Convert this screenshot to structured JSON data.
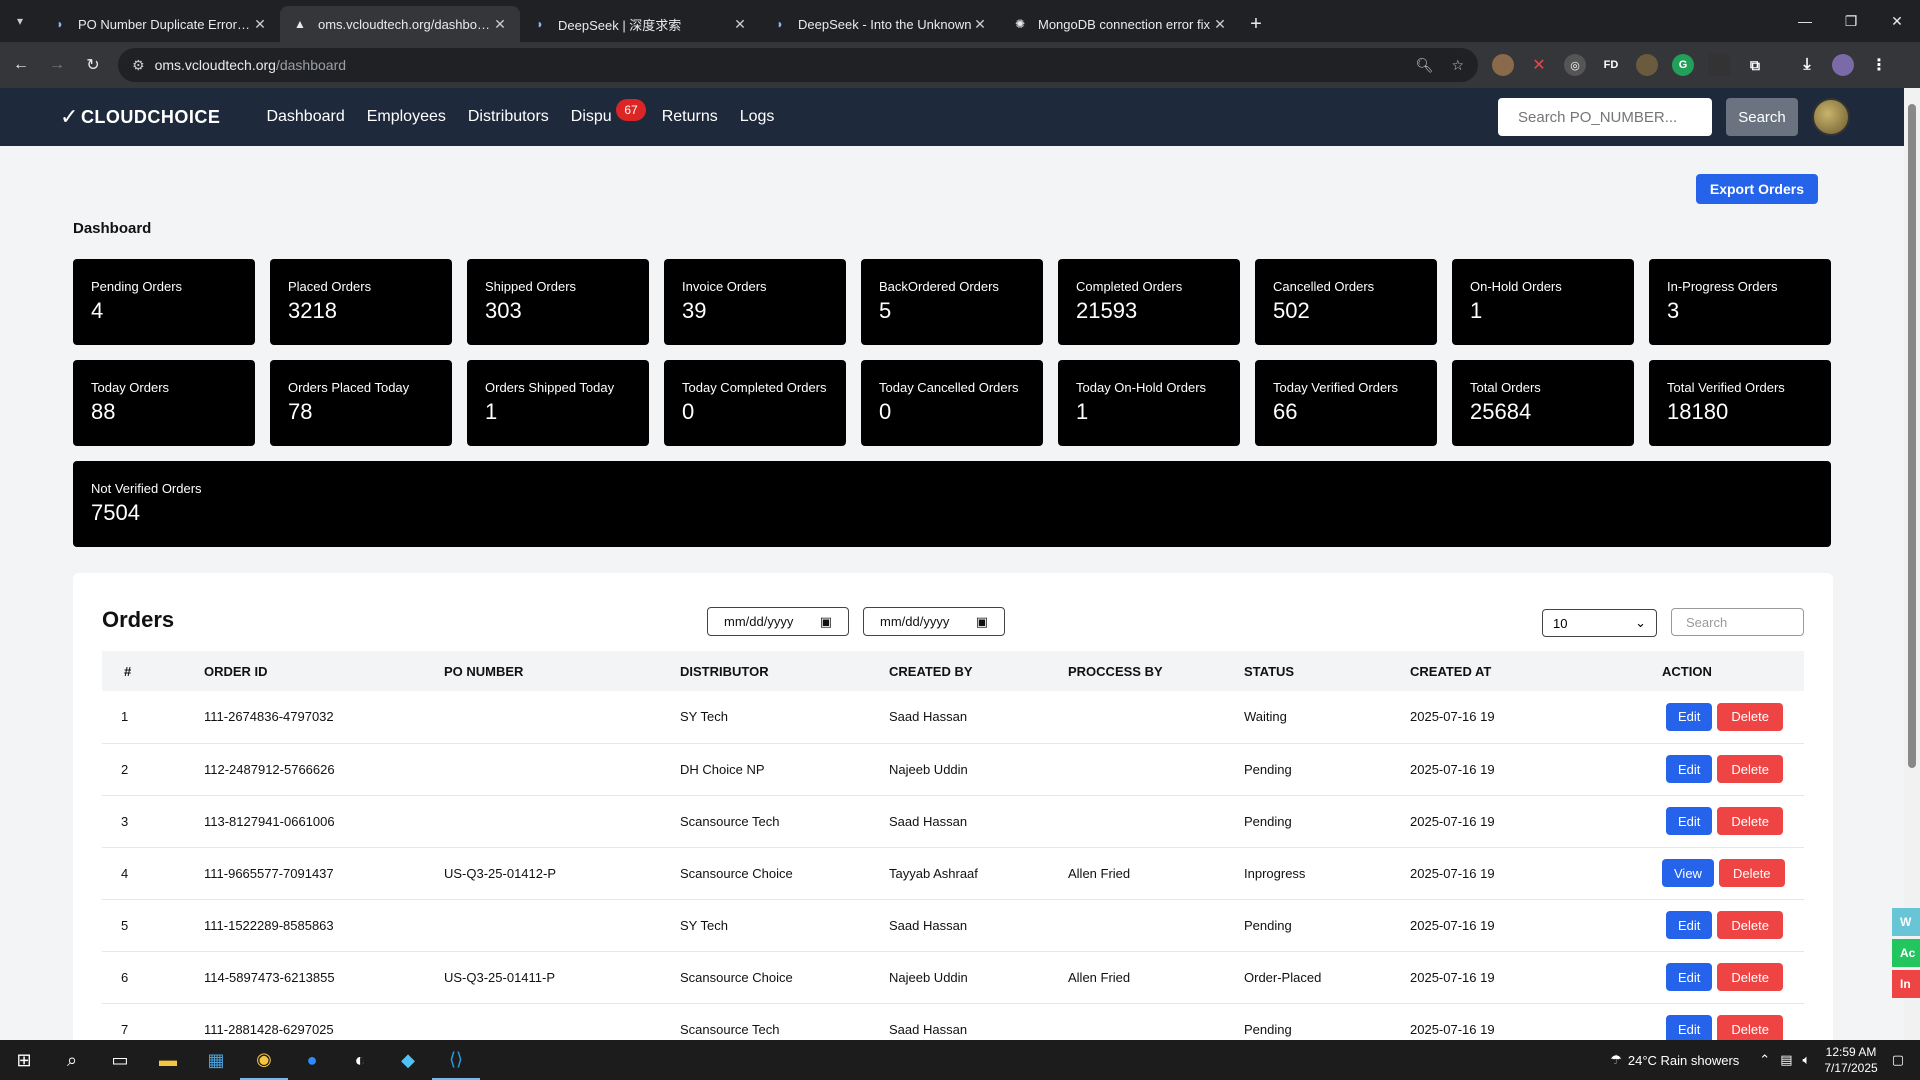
{
  "browser": {
    "tabs": [
      {
        "title": "PO Number Duplicate Error Exp",
        "icon": "deepseek-icon"
      },
      {
        "title": "oms.vcloudtech.org/dashboard",
        "icon": "vercel-icon",
        "active": true
      },
      {
        "title": "DeepSeek | 深度求索",
        "icon": "deepseek-icon"
      },
      {
        "title": "DeepSeek - Into the Unknown",
        "icon": "deepseek-icon"
      },
      {
        "title": "MongoDB connection error fix",
        "icon": "chatgpt-icon"
      }
    ],
    "url_host": "oms.vcloudtech.org",
    "url_path": "/dashboard"
  },
  "nav": {
    "logo": "CLOUDCHOICE",
    "links": [
      "Dashboard",
      "Employees",
      "Distributors",
      "Dispu",
      "Returns",
      "Logs"
    ],
    "disputes_badge": "67",
    "search_placeholder": "Search PO_NUMBER...",
    "search_button": "Search"
  },
  "dashboard": {
    "export_button": "Export Orders",
    "title": "Dashboard",
    "stats": [
      {
        "label": "Pending Orders",
        "value": "4"
      },
      {
        "label": "Placed Orders",
        "value": "3218"
      },
      {
        "label": "Shipped Orders",
        "value": "303"
      },
      {
        "label": "Invoice Orders",
        "value": "39"
      },
      {
        "label": "BackOrdered Orders",
        "value": "5"
      },
      {
        "label": "Completed Orders",
        "value": "21593"
      },
      {
        "label": "Cancelled Orders",
        "value": "502"
      },
      {
        "label": "On-Hold Orders",
        "value": "1"
      },
      {
        "label": "In-Progress Orders",
        "value": "3"
      },
      {
        "label": "Today Orders",
        "value": "88"
      },
      {
        "label": "Orders Placed Today",
        "value": "78"
      },
      {
        "label": "Orders Shipped Today",
        "value": "1"
      },
      {
        "label": "Today Completed Orders",
        "value": "0"
      },
      {
        "label": "Today Cancelled Orders",
        "value": "0"
      },
      {
        "label": "Today On-Hold Orders",
        "value": "1"
      },
      {
        "label": "Today Verified Orders",
        "value": "66"
      },
      {
        "label": "Total Orders",
        "value": "25684"
      },
      {
        "label": "Total Verified Orders",
        "value": "18180"
      },
      {
        "label": "Not Verified Orders",
        "value": "7504"
      }
    ]
  },
  "orders": {
    "title": "Orders",
    "date_from_placeholder": "mm/dd/yyyy",
    "date_to_placeholder": "mm/dd/yyyy",
    "per_page": "10",
    "search_placeholder": "Search",
    "columns": [
      "#",
      "ORDER ID",
      "PO NUMBER",
      "DISTRIBUTOR",
      "CREATED BY",
      "PROCCESS BY",
      "STATUS",
      "CREATED AT",
      "ACTION"
    ],
    "rows": [
      {
        "n": "1",
        "order_id": "111-2674836-4797032",
        "po": "",
        "distributor": "SY Tech",
        "created_by": "Saad Hassan",
        "processed_by": "",
        "status": "Waiting",
        "created_at": "2025-07-16 19",
        "action": "Edit"
      },
      {
        "n": "2",
        "order_id": "112-2487912-5766626",
        "po": "",
        "distributor": "DH Choice NP",
        "created_by": "Najeeb Uddin",
        "processed_by": "",
        "status": "Pending",
        "created_at": "2025-07-16 19",
        "action": "Edit"
      },
      {
        "n": "3",
        "order_id": "113-8127941-0661006",
        "po": "",
        "distributor": "Scansource Tech",
        "created_by": "Saad Hassan",
        "processed_by": "",
        "status": "Pending",
        "created_at": "2025-07-16 19",
        "action": "Edit"
      },
      {
        "n": "4",
        "order_id": "111-9665577-7091437",
        "po": "US-Q3-25-01412-P",
        "distributor": "Scansource Choice",
        "created_by": "Tayyab Ashraaf",
        "processed_by": "Allen Fried",
        "status": "Inprogress",
        "created_at": "2025-07-16 19",
        "action": "View"
      },
      {
        "n": "5",
        "order_id": "111-1522289-8585863",
        "po": "",
        "distributor": "SY Tech",
        "created_by": "Saad Hassan",
        "processed_by": "",
        "status": "Pending",
        "created_at": "2025-07-16 19",
        "action": "Edit"
      },
      {
        "n": "6",
        "order_id": "114-5897473-6213855",
        "po": "US-Q3-25-01411-P",
        "distributor": "Scansource Choice",
        "created_by": "Najeeb Uddin",
        "processed_by": "Allen Fried",
        "status": "Order-Placed",
        "created_at": "2025-07-16 19",
        "action": "Edit"
      },
      {
        "n": "7",
        "order_id": "111-2881428-6297025",
        "po": "",
        "distributor": "Scansource Tech",
        "created_by": "Saad Hassan",
        "processed_by": "",
        "status": "Pending",
        "created_at": "2025-07-16 19",
        "action": "Edit"
      }
    ],
    "delete_label": "Delete"
  },
  "side_tabs": [
    {
      "label": "W",
      "color": "#67c5d6"
    },
    {
      "label": "Ac",
      "color": "#22c55e"
    },
    {
      "label": "In",
      "color": "#ef4444"
    }
  ],
  "taskbar": {
    "weather": "24°C  Rain showers",
    "time": "12:59 AM",
    "date": "7/17/2025"
  }
}
